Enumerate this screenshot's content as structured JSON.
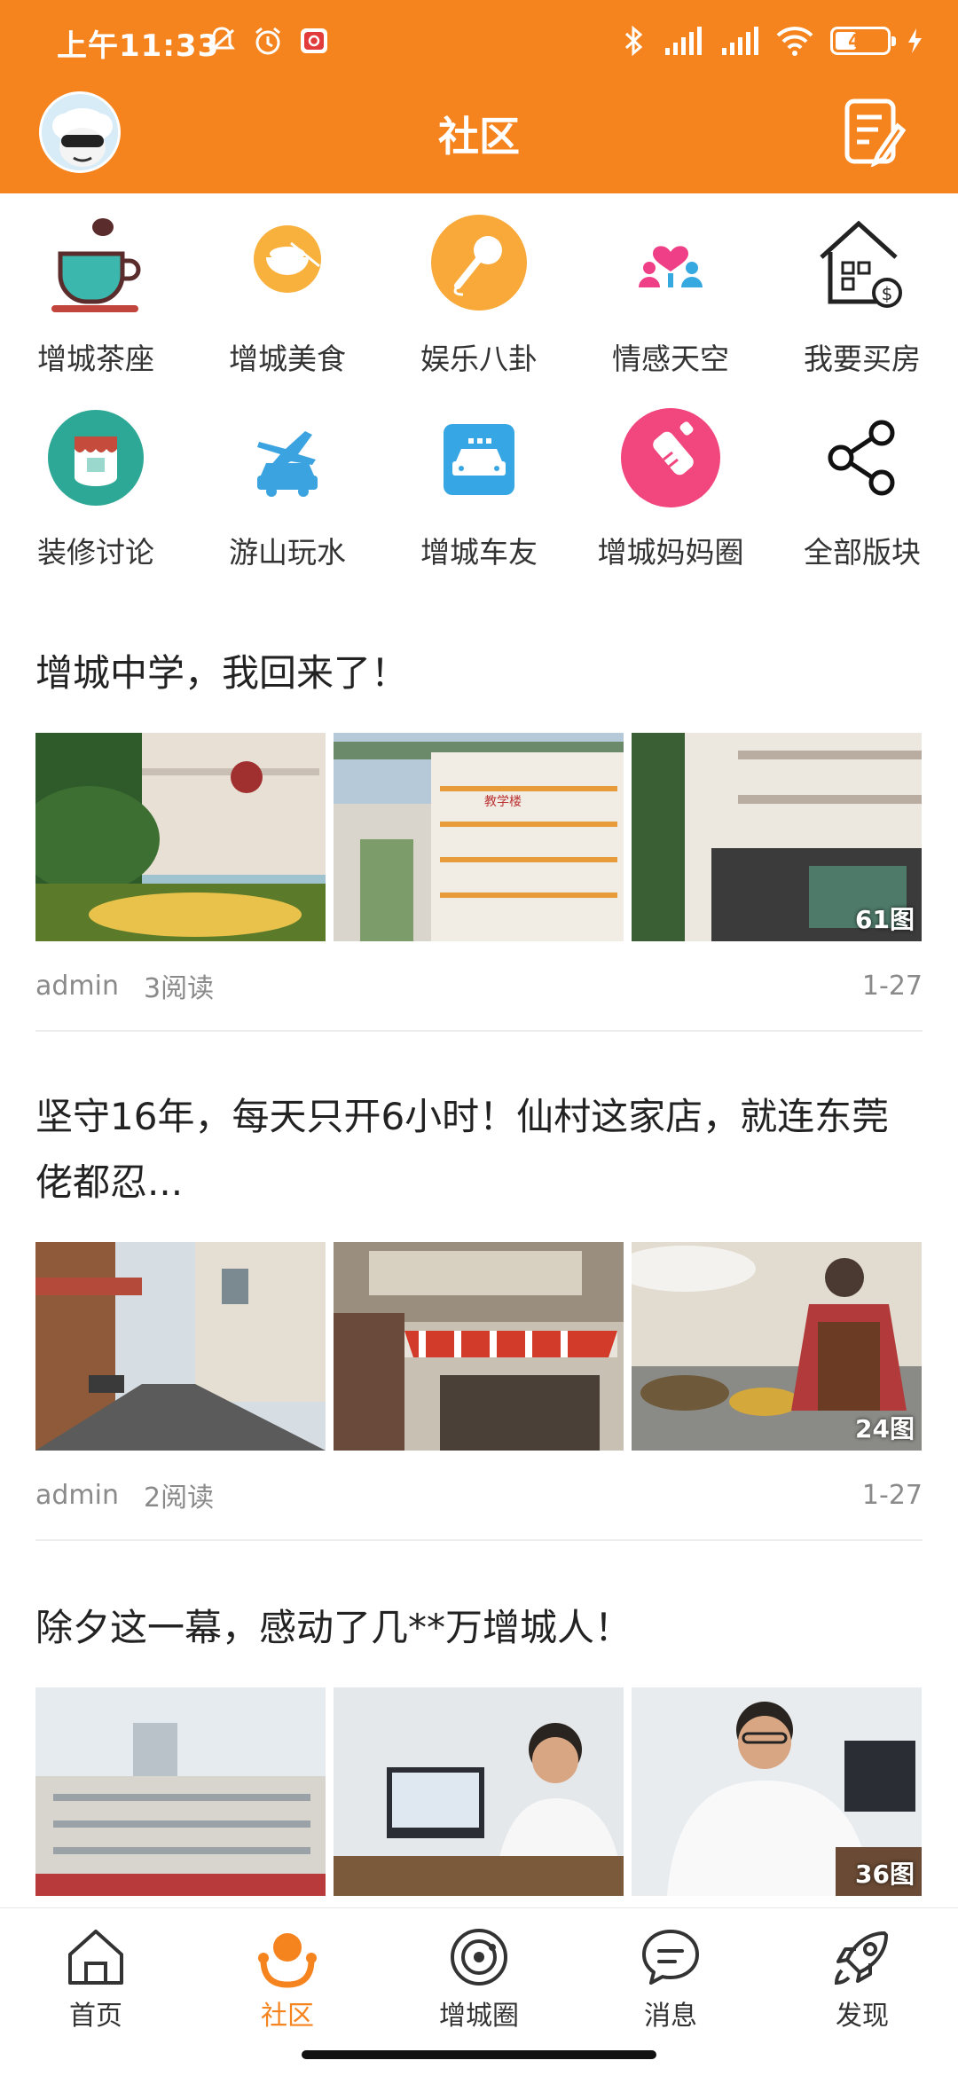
{
  "status_bar": {
    "time": "上午11:33",
    "battery": "47",
    "battery_level": 0.47
  },
  "header": {
    "title": "社区"
  },
  "categories": [
    {
      "label": "增城茶座",
      "icon": "tea-cup-icon"
    },
    {
      "label": "增城美食",
      "icon": "food-bowl-icon"
    },
    {
      "label": "娱乐八卦",
      "icon": "microphone-icon"
    },
    {
      "label": "情感天空",
      "icon": "couple-heart-icon"
    },
    {
      "label": "我要买房",
      "icon": "house-price-icon"
    },
    {
      "label": "装修讨论",
      "icon": "paint-bucket-icon"
    },
    {
      "label": "游山玩水",
      "icon": "plane-car-icon"
    },
    {
      "label": "增城车友",
      "icon": "car-icon"
    },
    {
      "label": "增城妈妈圈",
      "icon": "baby-bottle-icon"
    },
    {
      "label": "全部版块",
      "icon": "share-icon"
    }
  ],
  "posts": [
    {
      "title": "增城中学，我回来了！",
      "author": "admin",
      "reads": "3阅读",
      "date": "1-27",
      "photo_count": "61图"
    },
    {
      "title": "坚守16年，每天只开6小时！仙村这家店，就连东莞佬都忍...",
      "author": "admin",
      "reads": "2阅读",
      "date": "1-27",
      "photo_count": "24图"
    },
    {
      "title": "除夕这一幕，感动了几**万增城人！",
      "photo_count": "36图"
    }
  ],
  "bottom_nav": [
    {
      "label": "首页",
      "icon": "home-icon"
    },
    {
      "label": "社区",
      "icon": "community-icon",
      "active": true
    },
    {
      "label": "增城圈",
      "icon": "planet-circle-icon"
    },
    {
      "label": "消息",
      "icon": "message-bubble-icon"
    },
    {
      "label": "发现",
      "icon": "rocket-icon"
    }
  ],
  "colors": {
    "brand": "#f5841f",
    "text": "#222222",
    "meta": "#8a8a8a"
  }
}
